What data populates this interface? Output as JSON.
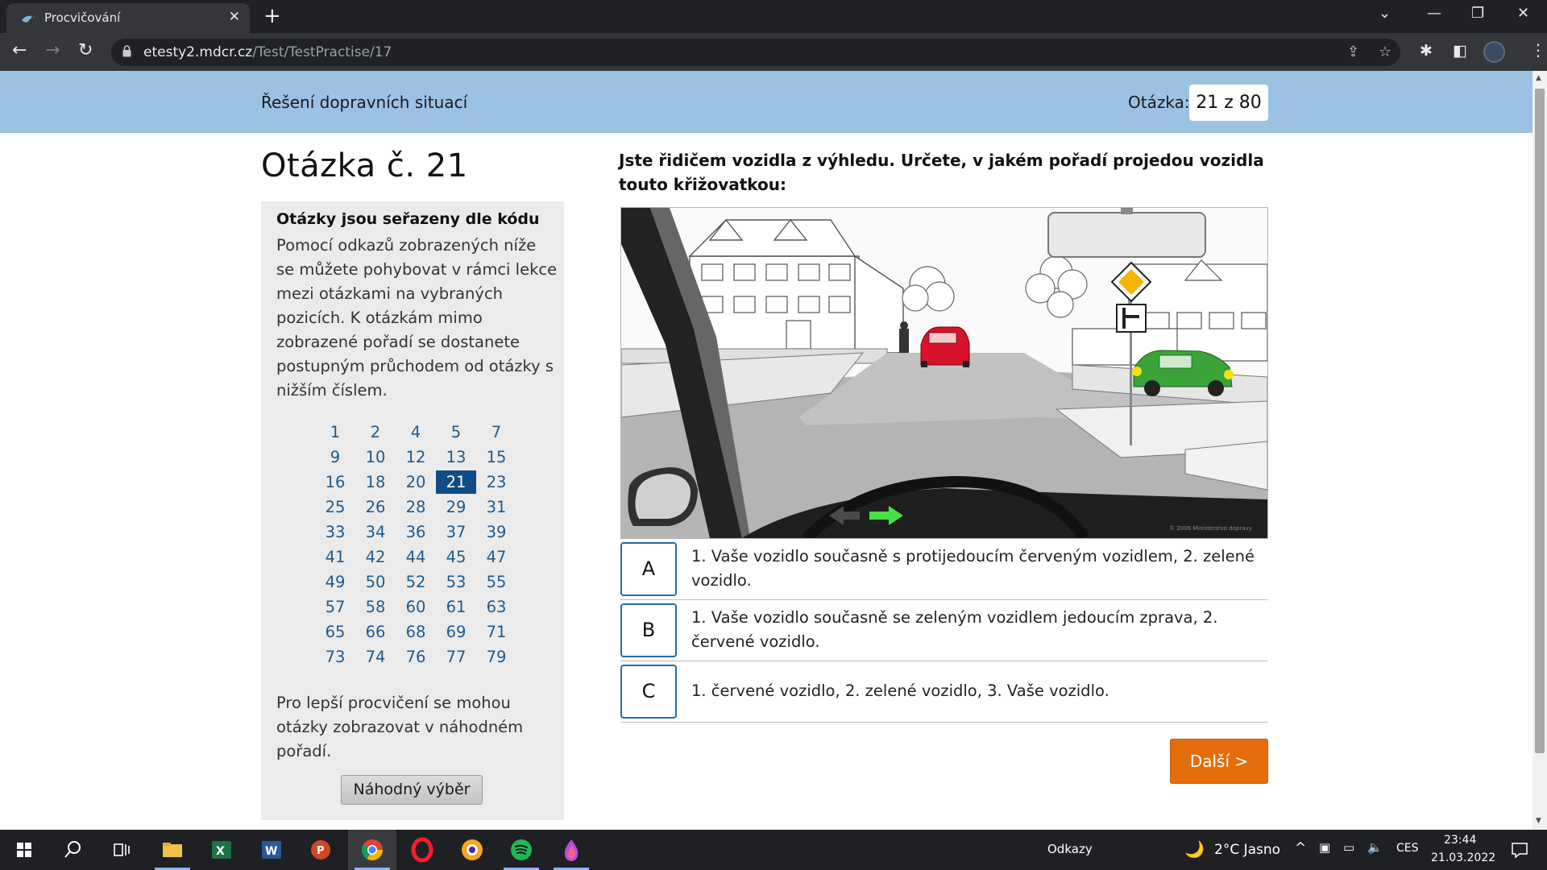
{
  "browser": {
    "tab_title": "Procvičování",
    "tab_close": "✕",
    "new_tab": "+",
    "url_host": "etesty2.mdcr.cz",
    "url_path": "/Test/TestPractise/17",
    "window_controls": [
      "chevron-down-icon",
      "minimize-icon",
      "restore-icon",
      "close-icon"
    ]
  },
  "header": {
    "section_name": "Řešení dopravních situací",
    "counter_label": "Otázka:",
    "counter_value": "21 z 80"
  },
  "page": {
    "title": "Otázka č. 21"
  },
  "sidebar": {
    "heading": "Otázky jsou seřazeny dle kódu",
    "text": "Pomocí odkazů zobrazených níže se můžete pohybovat v rámci lekce mezi otázkami na vybraných pozicích. K otázkám mimo zobrazené pořadí se dostanete postupným průchodem od otázky s nižším číslem.",
    "numbers": [
      [
        "1",
        "2",
        "4",
        "5",
        "7"
      ],
      [
        "9",
        "10",
        "12",
        "13",
        "15"
      ],
      [
        "16",
        "18",
        "20",
        "21",
        "23"
      ],
      [
        "25",
        "26",
        "28",
        "29",
        "31"
      ],
      [
        "33",
        "34",
        "36",
        "37",
        "39"
      ],
      [
        "41",
        "42",
        "44",
        "45",
        "47"
      ],
      [
        "49",
        "50",
        "52",
        "53",
        "55"
      ],
      [
        "57",
        "58",
        "60",
        "61",
        "63"
      ],
      [
        "65",
        "66",
        "68",
        "69",
        "71"
      ],
      [
        "73",
        "74",
        "76",
        "77",
        "79"
      ]
    ],
    "active_number": "21",
    "footer_text": "Pro lepší procvičení se mohou otázky zobrazovat v náhodném pořadí.",
    "random_button": "Náhodný výběr"
  },
  "question": {
    "text": "Jste řidičem vozidla z výhledu. Určete, v jakém pořadí projedou vozidla touto křižovatkou:",
    "image_copyright": "© 2006 Ministerstvo dopravy",
    "answers": [
      {
        "letter": "A",
        "text": "1. Vaše vozidlo současně s protijedoucím červeným vozidlem, 2. zelené vozidlo."
      },
      {
        "letter": "B",
        "text": "1. Vaše vozidlo současně se zeleným vozidlem jedoucím zprava, 2. červené vozidlo."
      },
      {
        "letter": "C",
        "text": "1. červené vozidlo, 2. zelené vozidlo, 3. Vaše vozidlo."
      }
    ],
    "next_button": "Další >"
  },
  "taskbar": {
    "links_label": "Odkazy",
    "weather": "2°C  Jasno",
    "language": "CES",
    "time": "23:44",
    "date": "21.03.2022"
  },
  "colors": {
    "header_bg": "#9bc2e2",
    "active_number_bg": "#0e4e84",
    "link": "#1f5a8c",
    "next_button": "#e36e0b",
    "answer_border": "#2a6aa6"
  }
}
